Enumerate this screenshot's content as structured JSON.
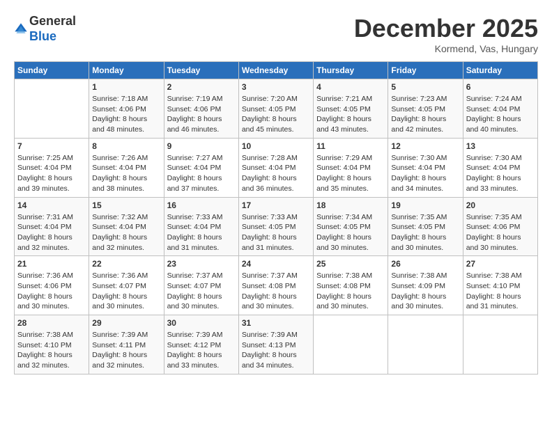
{
  "header": {
    "logo_general": "General",
    "logo_blue": "Blue",
    "month": "December 2025",
    "location": "Kormend, Vas, Hungary"
  },
  "weekdays": [
    "Sunday",
    "Monday",
    "Tuesday",
    "Wednesday",
    "Thursday",
    "Friday",
    "Saturday"
  ],
  "weeks": [
    [
      {
        "day": "",
        "sunrise": "",
        "sunset": "",
        "daylight": ""
      },
      {
        "day": "1",
        "sunrise": "Sunrise: 7:18 AM",
        "sunset": "Sunset: 4:06 PM",
        "daylight": "Daylight: 8 hours and 48 minutes."
      },
      {
        "day": "2",
        "sunrise": "Sunrise: 7:19 AM",
        "sunset": "Sunset: 4:06 PM",
        "daylight": "Daylight: 8 hours and 46 minutes."
      },
      {
        "day": "3",
        "sunrise": "Sunrise: 7:20 AM",
        "sunset": "Sunset: 4:05 PM",
        "daylight": "Daylight: 8 hours and 45 minutes."
      },
      {
        "day": "4",
        "sunrise": "Sunrise: 7:21 AM",
        "sunset": "Sunset: 4:05 PM",
        "daylight": "Daylight: 8 hours and 43 minutes."
      },
      {
        "day": "5",
        "sunrise": "Sunrise: 7:23 AM",
        "sunset": "Sunset: 4:05 PM",
        "daylight": "Daylight: 8 hours and 42 minutes."
      },
      {
        "day": "6",
        "sunrise": "Sunrise: 7:24 AM",
        "sunset": "Sunset: 4:04 PM",
        "daylight": "Daylight: 8 hours and 40 minutes."
      }
    ],
    [
      {
        "day": "7",
        "sunrise": "Sunrise: 7:25 AM",
        "sunset": "Sunset: 4:04 PM",
        "daylight": "Daylight: 8 hours and 39 minutes."
      },
      {
        "day": "8",
        "sunrise": "Sunrise: 7:26 AM",
        "sunset": "Sunset: 4:04 PM",
        "daylight": "Daylight: 8 hours and 38 minutes."
      },
      {
        "day": "9",
        "sunrise": "Sunrise: 7:27 AM",
        "sunset": "Sunset: 4:04 PM",
        "daylight": "Daylight: 8 hours and 37 minutes."
      },
      {
        "day": "10",
        "sunrise": "Sunrise: 7:28 AM",
        "sunset": "Sunset: 4:04 PM",
        "daylight": "Daylight: 8 hours and 36 minutes."
      },
      {
        "day": "11",
        "sunrise": "Sunrise: 7:29 AM",
        "sunset": "Sunset: 4:04 PM",
        "daylight": "Daylight: 8 hours and 35 minutes."
      },
      {
        "day": "12",
        "sunrise": "Sunrise: 7:30 AM",
        "sunset": "Sunset: 4:04 PM",
        "daylight": "Daylight: 8 hours and 34 minutes."
      },
      {
        "day": "13",
        "sunrise": "Sunrise: 7:30 AM",
        "sunset": "Sunset: 4:04 PM",
        "daylight": "Daylight: 8 hours and 33 minutes."
      }
    ],
    [
      {
        "day": "14",
        "sunrise": "Sunrise: 7:31 AM",
        "sunset": "Sunset: 4:04 PM",
        "daylight": "Daylight: 8 hours and 32 minutes."
      },
      {
        "day": "15",
        "sunrise": "Sunrise: 7:32 AM",
        "sunset": "Sunset: 4:04 PM",
        "daylight": "Daylight: 8 hours and 32 minutes."
      },
      {
        "day": "16",
        "sunrise": "Sunrise: 7:33 AM",
        "sunset": "Sunset: 4:04 PM",
        "daylight": "Daylight: 8 hours and 31 minutes."
      },
      {
        "day": "17",
        "sunrise": "Sunrise: 7:33 AM",
        "sunset": "Sunset: 4:05 PM",
        "daylight": "Daylight: 8 hours and 31 minutes."
      },
      {
        "day": "18",
        "sunrise": "Sunrise: 7:34 AM",
        "sunset": "Sunset: 4:05 PM",
        "daylight": "Daylight: 8 hours and 30 minutes."
      },
      {
        "day": "19",
        "sunrise": "Sunrise: 7:35 AM",
        "sunset": "Sunset: 4:05 PM",
        "daylight": "Daylight: 8 hours and 30 minutes."
      },
      {
        "day": "20",
        "sunrise": "Sunrise: 7:35 AM",
        "sunset": "Sunset: 4:06 PM",
        "daylight": "Daylight: 8 hours and 30 minutes."
      }
    ],
    [
      {
        "day": "21",
        "sunrise": "Sunrise: 7:36 AM",
        "sunset": "Sunset: 4:06 PM",
        "daylight": "Daylight: 8 hours and 30 minutes."
      },
      {
        "day": "22",
        "sunrise": "Sunrise: 7:36 AM",
        "sunset": "Sunset: 4:07 PM",
        "daylight": "Daylight: 8 hours and 30 minutes."
      },
      {
        "day": "23",
        "sunrise": "Sunrise: 7:37 AM",
        "sunset": "Sunset: 4:07 PM",
        "daylight": "Daylight: 8 hours and 30 minutes."
      },
      {
        "day": "24",
        "sunrise": "Sunrise: 7:37 AM",
        "sunset": "Sunset: 4:08 PM",
        "daylight": "Daylight: 8 hours and 30 minutes."
      },
      {
        "day": "25",
        "sunrise": "Sunrise: 7:38 AM",
        "sunset": "Sunset: 4:08 PM",
        "daylight": "Daylight: 8 hours and 30 minutes."
      },
      {
        "day": "26",
        "sunrise": "Sunrise: 7:38 AM",
        "sunset": "Sunset: 4:09 PM",
        "daylight": "Daylight: 8 hours and 30 minutes."
      },
      {
        "day": "27",
        "sunrise": "Sunrise: 7:38 AM",
        "sunset": "Sunset: 4:10 PM",
        "daylight": "Daylight: 8 hours and 31 minutes."
      }
    ],
    [
      {
        "day": "28",
        "sunrise": "Sunrise: 7:38 AM",
        "sunset": "Sunset: 4:10 PM",
        "daylight": "Daylight: 8 hours and 32 minutes."
      },
      {
        "day": "29",
        "sunrise": "Sunrise: 7:39 AM",
        "sunset": "Sunset: 4:11 PM",
        "daylight": "Daylight: 8 hours and 32 minutes."
      },
      {
        "day": "30",
        "sunrise": "Sunrise: 7:39 AM",
        "sunset": "Sunset: 4:12 PM",
        "daylight": "Daylight: 8 hours and 33 minutes."
      },
      {
        "day": "31",
        "sunrise": "Sunrise: 7:39 AM",
        "sunset": "Sunset: 4:13 PM",
        "daylight": "Daylight: 8 hours and 34 minutes."
      },
      {
        "day": "",
        "sunrise": "",
        "sunset": "",
        "daylight": ""
      },
      {
        "day": "",
        "sunrise": "",
        "sunset": "",
        "daylight": ""
      },
      {
        "day": "",
        "sunrise": "",
        "sunset": "",
        "daylight": ""
      }
    ]
  ]
}
